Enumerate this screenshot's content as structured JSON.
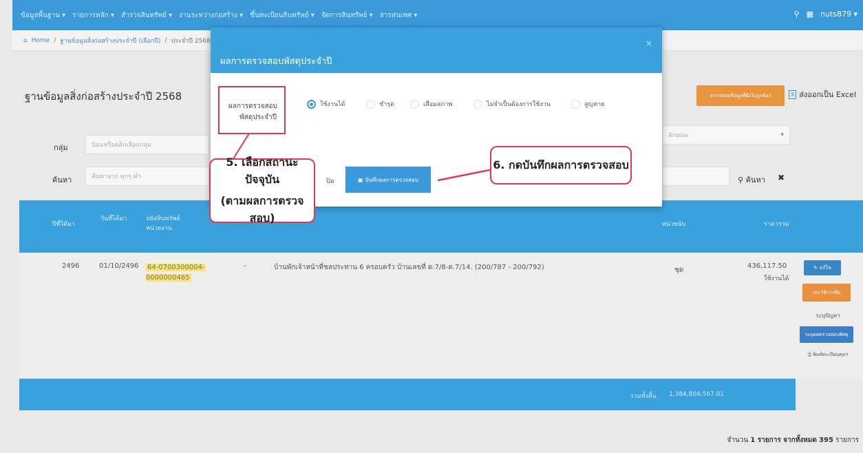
{
  "topnav": {
    "menus": [
      "ข้อมูลพื้นฐาน ▾",
      "รายการหลัก ▾",
      "สำรวจสินทรัพย์ ▾",
      "งานระหว่างก่อสร้าง ▾",
      "ขึ้นทะเบียนสินทรัพย์ ▾",
      "จัดการสินทรัพย์ ▾",
      "สารสนเทศ ▾"
    ],
    "user": "nuts879 ▾"
  },
  "breadcrumb": {
    "home": "Home",
    "parent": "ฐานข้อมูลสิ่งก่อสร้างประจำปี (เลือกปี)",
    "current": "ประจำปี 2568"
  },
  "page": {
    "title": "ฐานข้อมูลสิ่งก่อสร้างประจำปี 2568",
    "excel_label": "ส่งออกเป็น Excel",
    "orange_label": "ตรวจสอบข้อมูลที่ยังไม่ถูกต้อง"
  },
  "filters": {
    "group_label": "กลุ่ม",
    "group_placeholder": "ป้อนหรือคลิกเลือกกลุ่ม",
    "type_placeholder": "ลักษณะ",
    "search_label": "ค้นหา",
    "search_placeholder": "ค้นหาจาก ทุกๆ คำ",
    "search_button": "ค้นหา",
    "clear_button": "✖"
  },
  "table": {
    "headers": [
      "ปีที่ได้มา",
      "วันที่ได้มา",
      "รหัสสินทรัพย์ หน่วยงาน",
      "หน่วยนับ",
      "ราคารวม"
    ],
    "row": {
      "year": "2496",
      "date": "01/10/2496",
      "code": "64-0700300004-0000000465",
      "dash": "-",
      "description": "บ้านพักเจ้าหน้าที่ชลประทาน 6 ครอบครัว บ้านเลขที่ ด.7/8-ด.7/14. (200/787 - 200/792)",
      "unit": "ชุด",
      "price": "436,117.50",
      "status": "ใช้งานได้"
    },
    "actions": [
      "แก้ไข",
      "ประวัติการยืม",
      "ระบุปัญหา",
      "ระบุผลตรวจสอบพัสดุ",
      "พิมพ์ทะเบียนคุมฯ"
    ],
    "footer": {
      "label": "รวมทั้งสิ้น",
      "value": "1,384,804,567.01"
    },
    "count_prefix": "จำนวน",
    "count_mid": "1 รายการ จากทั้งหมด",
    "count_total": "395",
    "count_suffix": "รายการ"
  },
  "modal": {
    "title": "ผลการตรวจสอบพัสดุประจำปี",
    "field_label_1": "ผลการตรวจสอบ",
    "field_label_2": "พัสดุประจำปี",
    "options": [
      "ใช้งานได้",
      "ชำรุด",
      "เสื่อมสภาพ",
      "ไม่จำเป็นต้องการใช้งาน",
      "สูญหาย"
    ],
    "selected": "ใช้งานได้",
    "close_button": "ปิด",
    "save_button": "บันทึกผลการตรวจสอบ"
  },
  "annotations": {
    "step5_line1": "5. เลือกสถานะปัจจุบัน",
    "step5_line2": "(ตามผลการตรวจสอบ)",
    "step6": "6. กดบันทึกผลการตรวจสอบ"
  },
  "colors": {
    "primary": "#3a9ad9",
    "orange": "#e89542",
    "annotation": "#e0394a",
    "highlight": "#f6e27a"
  }
}
